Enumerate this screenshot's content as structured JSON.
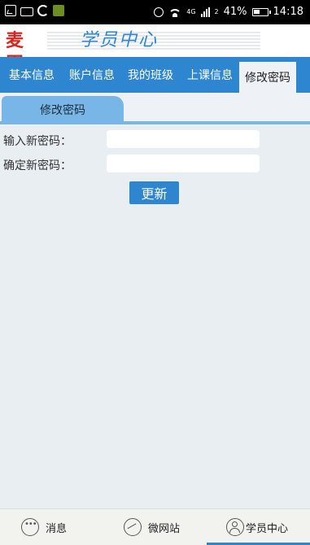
{
  "status_bar": {
    "network_label": "4G",
    "network_label_2": "2",
    "battery": "41%",
    "time": "14:18",
    "icons": [
      "gallery-icon",
      "keyboard-icon",
      "sync-icon",
      "app-icon",
      "alarm-icon",
      "wifi-icon",
      "signal-icon",
      "battery-icon"
    ]
  },
  "header": {
    "logo_text": "麦田",
    "title": "学员中心"
  },
  "nav": {
    "tabs": [
      {
        "label": "基本信息"
      },
      {
        "label": "账户信息"
      },
      {
        "label": "我的班级"
      },
      {
        "label": "上课信息"
      },
      {
        "label": "修改密码",
        "active": true
      }
    ]
  },
  "section": {
    "tab_label": "修改密码"
  },
  "form": {
    "new_password_label": "输入新密码：",
    "new_password_value": "",
    "confirm_password_label": "确定新密码：",
    "confirm_password_value": "",
    "submit_label": "更新"
  },
  "bottom_nav": {
    "items": [
      {
        "label": "消息",
        "icon": "message-icon"
      },
      {
        "label": "微网站",
        "icon": "website-icon"
      },
      {
        "label": "学员中心",
        "icon": "user-icon",
        "active": true
      }
    ]
  },
  "colors": {
    "accent": "#2e86d1",
    "tab_light": "#79b6e8",
    "background": "#e9eef3"
  }
}
